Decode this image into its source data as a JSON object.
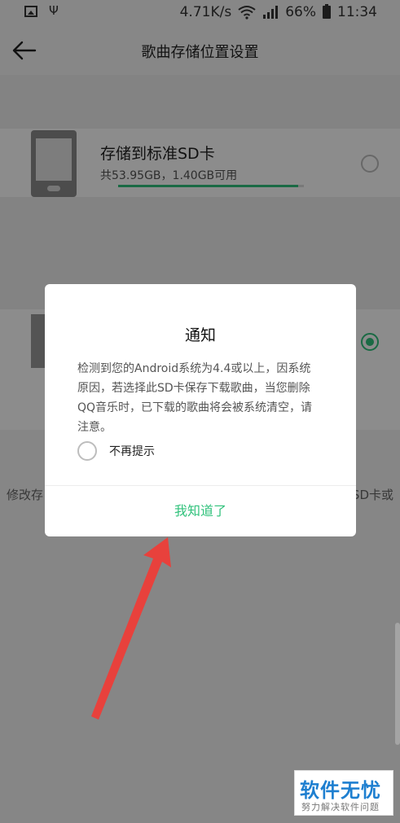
{
  "status_bar": {
    "net_speed": "4.71K/s",
    "battery": "66%",
    "time": "11:34",
    "left_icons": [
      "gallery-icon",
      "usb-icon"
    ],
    "right_icons": [
      "wifi-icon",
      "signal-icon",
      "battery-icon"
    ]
  },
  "header": {
    "title": "歌曲存储位置设置",
    "back_icon": "back-arrow-icon"
  },
  "storage_options": [
    {
      "title": "存储到标准SD卡",
      "subtitle": "共53.95GB，1.40GB可用",
      "usage_fraction": 0.97,
      "selected": false
    },
    {
      "selected": true
    }
  ],
  "background_hint": {
    "left": "修改存",
    "right": "SD卡或"
  },
  "dialog": {
    "title": "通知",
    "body": "检测到您的Android系统为4.4或以上，因系统原因，若选择此SD卡保存下载歌曲，当您删除QQ音乐时，已下载的歌曲将会被系统清空，请注意。",
    "checkbox_label": "不再提示",
    "checkbox_checked": false,
    "confirm_label": "我知道了"
  },
  "colors": {
    "accent": "#31c27c",
    "annotation_arrow": "#e8413c"
  },
  "watermark": {
    "main": "软件无忧",
    "sub": "努力解决软件问题"
  }
}
